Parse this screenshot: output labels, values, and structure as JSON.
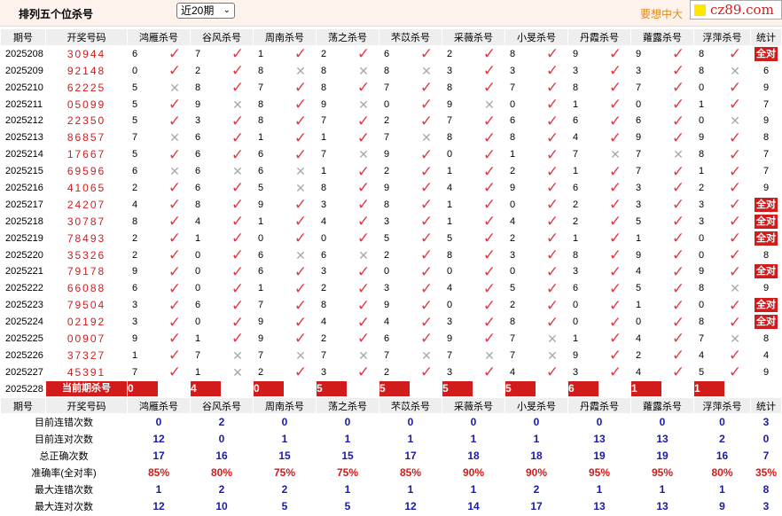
{
  "header": {
    "title": "排列五个位杀号",
    "period_option": "近20期",
    "promo_text": "要想中大",
    "brand": "cz89.com"
  },
  "columns": {
    "issue": "期号",
    "winning": "开奖号码",
    "kills": [
      "鸿雁杀号",
      "谷风杀号",
      "周南杀号",
      "荡之杀号",
      "芣苡杀号",
      "采薇杀号",
      "小旻杀号",
      "丹霞杀号",
      "蕹露杀号",
      "浮萍杀号"
    ],
    "stat": "统计"
  },
  "rows": [
    {
      "issue": "2025208",
      "winning": "30944",
      "kills": [
        "6",
        "7",
        "1",
        "2",
        "6",
        "2",
        "8",
        "9",
        "9",
        "8"
      ],
      "marks": [
        "v",
        "v",
        "v",
        "v",
        "v",
        "v",
        "v",
        "v",
        "v",
        "v"
      ],
      "stat": "全对"
    },
    {
      "issue": "2025209",
      "winning": "92148",
      "kills": [
        "0",
        "2",
        "8",
        "8",
        "8",
        "3",
        "3",
        "3",
        "3",
        "8"
      ],
      "marks": [
        "v",
        "v",
        "x",
        "x",
        "x",
        "v",
        "v",
        "v",
        "v",
        "x"
      ],
      "stat": "6"
    },
    {
      "issue": "2025210",
      "winning": "62225",
      "kills": [
        "5",
        "8",
        "7",
        "8",
        "7",
        "8",
        "7",
        "8",
        "7",
        "0"
      ],
      "marks": [
        "x",
        "v",
        "v",
        "v",
        "v",
        "v",
        "v",
        "v",
        "v",
        "v"
      ],
      "stat": "9"
    },
    {
      "issue": "2025211",
      "winning": "05099",
      "kills": [
        "5",
        "9",
        "8",
        "9",
        "0",
        "9",
        "0",
        "1",
        "0",
        "1"
      ],
      "marks": [
        "v",
        "x",
        "v",
        "x",
        "v",
        "x",
        "v",
        "v",
        "v",
        "v"
      ],
      "stat": "7"
    },
    {
      "issue": "2025212",
      "winning": "22350",
      "kills": [
        "5",
        "3",
        "8",
        "7",
        "2",
        "7",
        "6",
        "6",
        "6",
        "0"
      ],
      "marks": [
        "v",
        "v",
        "v",
        "v",
        "v",
        "v",
        "v",
        "v",
        "v",
        "x"
      ],
      "stat": "9"
    },
    {
      "issue": "2025213",
      "winning": "86857",
      "kills": [
        "7",
        "6",
        "1",
        "1",
        "7",
        "8",
        "8",
        "4",
        "9",
        "9"
      ],
      "marks": [
        "x",
        "v",
        "v",
        "v",
        "x",
        "v",
        "v",
        "v",
        "v",
        "v"
      ],
      "stat": "8"
    },
    {
      "issue": "2025214",
      "winning": "17667",
      "kills": [
        "5",
        "6",
        "6",
        "7",
        "9",
        "0",
        "1",
        "7",
        "7",
        "8"
      ],
      "marks": [
        "v",
        "v",
        "v",
        "x",
        "v",
        "v",
        "v",
        "x",
        "x",
        "v"
      ],
      "stat": "7"
    },
    {
      "issue": "2025215",
      "winning": "69596",
      "kills": [
        "6",
        "6",
        "6",
        "1",
        "2",
        "1",
        "2",
        "1",
        "7",
        "1"
      ],
      "marks": [
        "x",
        "x",
        "x",
        "v",
        "v",
        "v",
        "v",
        "v",
        "v",
        "v"
      ],
      "stat": "7"
    },
    {
      "issue": "2025216",
      "winning": "41065",
      "kills": [
        "2",
        "6",
        "5",
        "8",
        "9",
        "4",
        "9",
        "6",
        "3",
        "2"
      ],
      "marks": [
        "v",
        "v",
        "x",
        "v",
        "v",
        "v",
        "v",
        "v",
        "v",
        "v"
      ],
      "stat": "9"
    },
    {
      "issue": "2025217",
      "winning": "24207",
      "kills": [
        "4",
        "8",
        "9",
        "3",
        "8",
        "1",
        "0",
        "2",
        "3",
        "3"
      ],
      "marks": [
        "v",
        "v",
        "v",
        "v",
        "v",
        "v",
        "v",
        "v",
        "v",
        "v"
      ],
      "stat": "全对"
    },
    {
      "issue": "2025218",
      "winning": "30787",
      "kills": [
        "8",
        "4",
        "1",
        "4",
        "3",
        "1",
        "4",
        "2",
        "5",
        "3"
      ],
      "marks": [
        "v",
        "v",
        "v",
        "v",
        "v",
        "v",
        "v",
        "v",
        "v",
        "v"
      ],
      "stat": "全对"
    },
    {
      "issue": "2025219",
      "winning": "78493",
      "kills": [
        "2",
        "1",
        "0",
        "0",
        "5",
        "5",
        "2",
        "1",
        "1",
        "0"
      ],
      "marks": [
        "v",
        "v",
        "v",
        "v",
        "v",
        "v",
        "v",
        "v",
        "v",
        "v"
      ],
      "stat": "全对"
    },
    {
      "issue": "2025220",
      "winning": "35326",
      "kills": [
        "2",
        "0",
        "6",
        "6",
        "2",
        "8",
        "3",
        "8",
        "9",
        "0"
      ],
      "marks": [
        "v",
        "v",
        "x",
        "x",
        "v",
        "v",
        "v",
        "v",
        "v",
        "v"
      ],
      "stat": "8"
    },
    {
      "issue": "2025221",
      "winning": "79178",
      "kills": [
        "9",
        "0",
        "6",
        "3",
        "0",
        "0",
        "0",
        "3",
        "4",
        "9"
      ],
      "marks": [
        "v",
        "v",
        "v",
        "v",
        "v",
        "v",
        "v",
        "v",
        "v",
        "v"
      ],
      "stat": "全对"
    },
    {
      "issue": "2025222",
      "winning": "66088",
      "kills": [
        "6",
        "0",
        "1",
        "2",
        "3",
        "4",
        "5",
        "6",
        "5",
        "8"
      ],
      "marks": [
        "v",
        "v",
        "v",
        "v",
        "v",
        "v",
        "v",
        "v",
        "v",
        "x"
      ],
      "stat": "9"
    },
    {
      "issue": "2025223",
      "winning": "79504",
      "kills": [
        "3",
        "6",
        "7",
        "8",
        "9",
        "0",
        "2",
        "0",
        "1",
        "0"
      ],
      "marks": [
        "v",
        "v",
        "v",
        "v",
        "v",
        "v",
        "v",
        "v",
        "v",
        "v"
      ],
      "stat": "全对"
    },
    {
      "issue": "2025224",
      "winning": "02192",
      "kills": [
        "3",
        "0",
        "9",
        "4",
        "4",
        "3",
        "8",
        "0",
        "0",
        "8"
      ],
      "marks": [
        "v",
        "v",
        "v",
        "v",
        "v",
        "v",
        "v",
        "v",
        "v",
        "v"
      ],
      "stat": "全对"
    },
    {
      "issue": "2025225",
      "winning": "00907",
      "kills": [
        "9",
        "1",
        "9",
        "2",
        "6",
        "9",
        "7",
        "1",
        "4",
        "7"
      ],
      "marks": [
        "v",
        "v",
        "v",
        "v",
        "v",
        "v",
        "x",
        "v",
        "v",
        "x"
      ],
      "stat": "8"
    },
    {
      "issue": "2025226",
      "winning": "37327",
      "kills": [
        "1",
        "7",
        "7",
        "7",
        "7",
        "7",
        "7",
        "9",
        "2",
        "4"
      ],
      "marks": [
        "v",
        "x",
        "x",
        "x",
        "x",
        "x",
        "x",
        "v",
        "v",
        "v"
      ],
      "stat": "4"
    },
    {
      "issue": "2025227",
      "winning": "45391",
      "kills": [
        "7",
        "1",
        "2",
        "3",
        "2",
        "3",
        "4",
        "3",
        "4",
        "5"
      ],
      "marks": [
        "v",
        "x",
        "v",
        "v",
        "v",
        "v",
        "v",
        "v",
        "v",
        "v"
      ],
      "stat": "9"
    }
  ],
  "current": {
    "issue": "2025228",
    "label": "当前期杀号",
    "kills": [
      "0",
      "4",
      "0",
      "5",
      "5",
      "5",
      "5",
      "6",
      "1",
      "1"
    ]
  },
  "summary": {
    "header_issue": "期号",
    "header_winning": "开奖号码",
    "rows": [
      {
        "label": "目前连错次数",
        "values": [
          "0",
          "2",
          "0",
          "0",
          "0",
          "0",
          "0",
          "0",
          "0",
          "0",
          "3"
        ]
      },
      {
        "label": "目前连对次数",
        "values": [
          "12",
          "0",
          "1",
          "1",
          "1",
          "1",
          "1",
          "13",
          "13",
          "2",
          "0"
        ]
      },
      {
        "label": "总正确次数",
        "values": [
          "17",
          "16",
          "15",
          "15",
          "17",
          "18",
          "18",
          "19",
          "19",
          "16",
          "7"
        ]
      },
      {
        "label": "准确率(全对率)",
        "values": [
          "85%",
          "80%",
          "75%",
          "75%",
          "85%",
          "90%",
          "90%",
          "95%",
          "95%",
          "80%",
          "35%"
        ]
      },
      {
        "label": "最大连错次数",
        "values": [
          "1",
          "2",
          "2",
          "1",
          "1",
          "1",
          "2",
          "1",
          "1",
          "1",
          "8"
        ]
      },
      {
        "label": "最大连对次数",
        "values": [
          "12",
          "10",
          "5",
          "5",
          "12",
          "14",
          "17",
          "13",
          "13",
          "9",
          "3"
        ]
      }
    ]
  }
}
